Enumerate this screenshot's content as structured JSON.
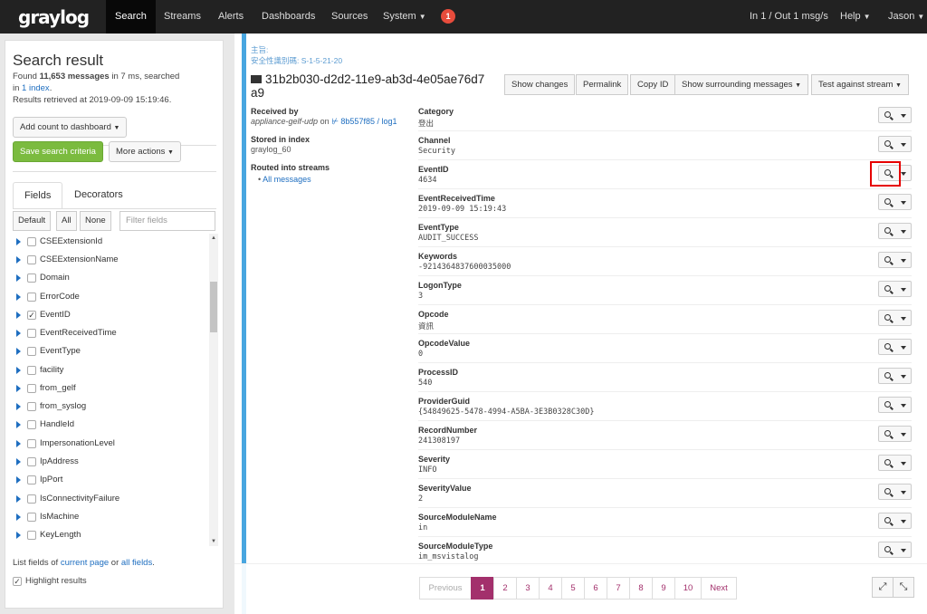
{
  "nav": {
    "logo": "graylog",
    "items": [
      "Search",
      "Streams",
      "Alerts",
      "Dashboards",
      "Sources",
      "System"
    ],
    "badge": "1",
    "throughput": "In 1 / Out 1 msg/s",
    "help": "Help",
    "user": "Jason"
  },
  "sidebar": {
    "title": "Search result",
    "found_prefix": "Found ",
    "found_count": "11,653 messages",
    "found_suffix": " in 7 ms, searched",
    "in_word": "in ",
    "index_link": "1 index",
    "retrieved": "Results retrieved at 2019-09-09 15:19:46.",
    "add_count": "Add count to dashboard",
    "save_search": "Save search criteria",
    "more_actions": "More actions",
    "tab_fields": "Fields",
    "tab_decorators": "Decorators",
    "seg_default": "Default",
    "seg_all": "All",
    "seg_none": "None",
    "filter_placeholder": "Filter fields",
    "fields": [
      {
        "name": "CSEExtensionId",
        "checked": false
      },
      {
        "name": "CSEExtensionName",
        "checked": false
      },
      {
        "name": "Domain",
        "checked": false
      },
      {
        "name": "ErrorCode",
        "checked": false
      },
      {
        "name": "EventID",
        "checked": true
      },
      {
        "name": "EventReceivedTime",
        "checked": false
      },
      {
        "name": "EventType",
        "checked": false
      },
      {
        "name": "facility",
        "checked": false
      },
      {
        "name": "from_gelf",
        "checked": false
      },
      {
        "name": "from_syslog",
        "checked": false
      },
      {
        "name": "HandleId",
        "checked": false
      },
      {
        "name": "ImpersonationLevel",
        "checked": false
      },
      {
        "name": "IpAddress",
        "checked": false
      },
      {
        "name": "IpPort",
        "checked": false
      },
      {
        "name": "IsConnectivityFailure",
        "checked": false
      },
      {
        "name": "IsMachine",
        "checked": false
      },
      {
        "name": "KeyLength",
        "checked": false
      }
    ],
    "list_note_prefix": "List fields of ",
    "current_page": "current page",
    "list_note_mid": " or ",
    "all_fields": "all fields",
    "list_note_end": ".",
    "highlight": "Highlight results"
  },
  "message": {
    "meta_line1": "主旨:",
    "meta_line2": "安全性識別碼: S-1-5-21-20",
    "id_line1": "31b2b030-d2d2-11e9-ab3d-4e05ae76d7",
    "id_line2": "a9",
    "toolbar": [
      "Show changes",
      "Permalink",
      "Copy ID",
      "Show surrounding messages",
      "Test against stream"
    ],
    "received_label": "Received by",
    "received_input": "appliance-gelf-udp",
    "received_on": " on ",
    "received_node": "⊬ 8b557f85 / log1",
    "stored_label": "Stored in index",
    "stored_value": "graylog_60",
    "routed_label": "Routed into streams",
    "stream": "All messages",
    "fields": [
      {
        "key": "Category",
        "value": "登出"
      },
      {
        "key": "Channel",
        "value": "Security"
      },
      {
        "key": "EventID",
        "value": "4634"
      },
      {
        "key": "EventReceivedTime",
        "value": "2019-09-09 15:19:43"
      },
      {
        "key": "EventType",
        "value": "AUDIT_SUCCESS"
      },
      {
        "key": "Keywords",
        "value": "-9214364837600035000"
      },
      {
        "key": "LogonType",
        "value": "3"
      },
      {
        "key": "Opcode",
        "value": "資訊"
      },
      {
        "key": "OpcodeValue",
        "value": "0"
      },
      {
        "key": "ProcessID",
        "value": "540"
      },
      {
        "key": "ProviderGuid",
        "value": "{54849625-5478-4994-A5BA-3E3B0328C30D}"
      },
      {
        "key": "RecordNumber",
        "value": "241308197"
      },
      {
        "key": "Severity",
        "value": "INFO"
      },
      {
        "key": "SeverityValue",
        "value": "2"
      },
      {
        "key": "SourceModuleName",
        "value": "in"
      },
      {
        "key": "SourceModuleType",
        "value": "im_msvistalog"
      }
    ]
  },
  "pagination": {
    "previous": "Previous",
    "pages": [
      "1",
      "2",
      "3",
      "4",
      "5",
      "6",
      "7",
      "8",
      "9",
      "10"
    ],
    "next": "Next",
    "current": "1"
  },
  "colors": {
    "accent": "#a3306c",
    "link": "#1e6ec0",
    "green": "#7bbb3f",
    "highlight_box": "#e60000",
    "left_bar": "#48a6e0"
  }
}
